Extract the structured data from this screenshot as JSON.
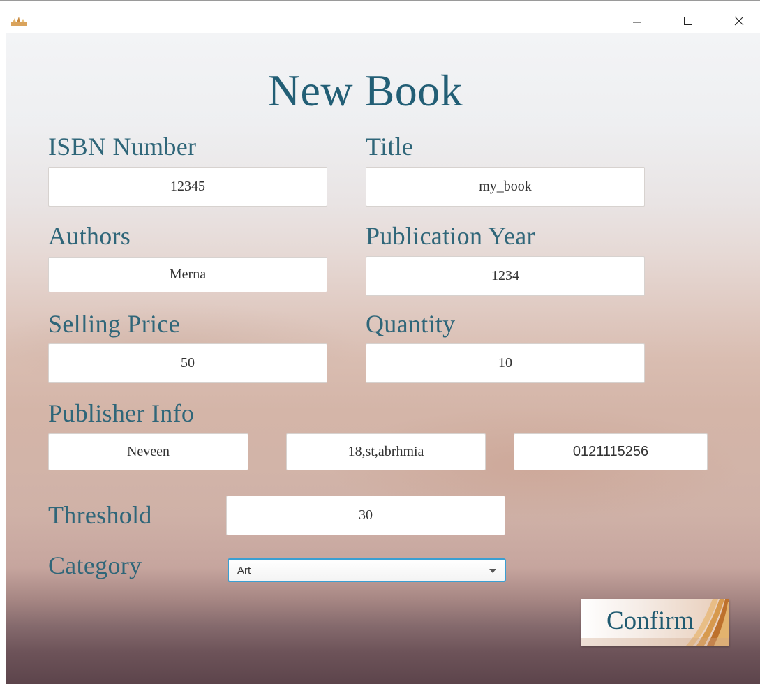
{
  "window": {
    "controls": [
      "minimize",
      "maximize",
      "close"
    ]
  },
  "form": {
    "heading": "New Book",
    "isbn": {
      "label": "ISBN Number",
      "value": "12345"
    },
    "title": {
      "label": "Title",
      "value": "my_book"
    },
    "authors": {
      "label": "Authors",
      "value": "Merna"
    },
    "publication_year": {
      "label": "Publication Year",
      "value": "1234"
    },
    "selling_price": {
      "label": "Selling Price",
      "value": "50"
    },
    "quantity": {
      "label": "Quantity",
      "value": "10"
    },
    "publisher": {
      "label": "Publisher Info",
      "name": "Neveen",
      "address": "18,st,abrhmia",
      "phone": "0121115256"
    },
    "threshold": {
      "label": "Threshold",
      "value": "30"
    },
    "category": {
      "label": "Category",
      "selected": "Art"
    },
    "confirm_label": "Confirm"
  },
  "colors": {
    "heading": "#225e75",
    "label": "#2f6679",
    "select_border": "#3a9fd2"
  },
  "icons": {
    "app": "books-app-icon",
    "minimize": "minimize-icon",
    "maximize": "maximize-icon",
    "close": "close-icon",
    "dropdown": "chevron-down-icon"
  }
}
